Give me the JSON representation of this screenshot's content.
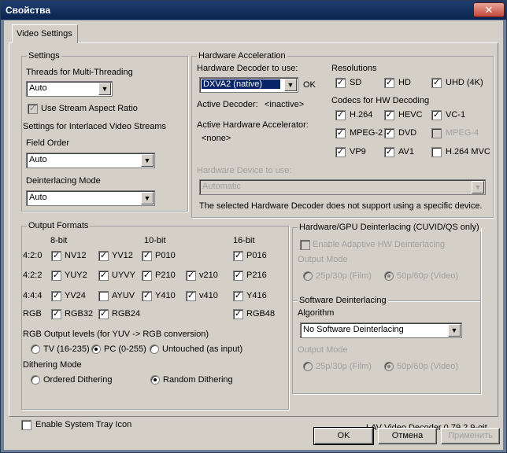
{
  "window": {
    "title": "Свойства",
    "close": "✕"
  },
  "tab": "Video Settings",
  "settings": {
    "group": "Settings",
    "threads_label": "Threads for Multi-Threading",
    "threads_value": "Auto",
    "aspect_label": "Use Stream Aspect Ratio",
    "interlaced_label": "Settings for Interlaced Video Streams",
    "field_order_label": "Field Order",
    "field_order_value": "Auto",
    "deint_mode_label": "Deinterlacing Mode",
    "deint_mode_value": "Auto"
  },
  "hwaccel": {
    "group": "Hardware Acceleration",
    "decoder_label": "Hardware Decoder to use:",
    "decoder_value": "DXVA2 (native)",
    "ok": "OK",
    "active_decoder_label": "Active Decoder:",
    "active_decoder_value": "<inactive>",
    "active_accel_label": "Active Hardware Accelerator:",
    "active_accel_value": "<none>",
    "device_label": "Hardware Device to use:",
    "device_value": "Automatic",
    "note": "The selected Hardware Decoder does not support using a specific device.",
    "resolutions_label": "Resolutions",
    "res": [
      "SD",
      "HD",
      "UHD (4K)"
    ],
    "codecs_label": "Codecs for HW Decoding",
    "codecs": [
      "H.264",
      "HEVC",
      "VC-1",
      "MPEG-2",
      "DVD",
      "MPEG-4",
      "VP9",
      "AV1",
      "H.264 MVC"
    ]
  },
  "output": {
    "group": "Output Formats",
    "h8": "8-bit",
    "h10": "10-bit",
    "h16": "16-bit",
    "rows": [
      "4:2:0",
      "4:2:2",
      "4:4:4",
      "RGB"
    ],
    "fmt": [
      "NV12",
      "YV12",
      "P010",
      "P016",
      "YUY2",
      "UYVY",
      "P210",
      "v210",
      "P216",
      "YV24",
      "AYUV",
      "Y410",
      "v410",
      "Y416",
      "RGB32",
      "RGB24",
      "RGB48"
    ],
    "levels_label": "RGB Output levels (for YUV -> RGB conversion)",
    "levels": [
      "TV (16-235)",
      "PC (0-255)",
      "Untouched (as input)"
    ],
    "dither_label": "Dithering Mode",
    "dither": [
      "Ordered Dithering",
      "Random Dithering"
    ]
  },
  "gpu_deint": {
    "group": "Hardware/GPU Deinterlacing (CUVID/QS only)",
    "adaptive": "Enable Adaptive HW Deinterlacing",
    "out_mode": "Output Mode",
    "opt1": "25p/30p (Film)",
    "opt2": "50p/60p (Video)"
  },
  "sw_deint": {
    "group": "Software Deinterlacing",
    "algo_label": "Algorithm",
    "algo_value": "No Software Deinterlacing",
    "out_mode": "Output Mode",
    "opt1": "25p/30p (Film)",
    "opt2": "50p/60p (Video)"
  },
  "tray": "Enable System Tray Icon",
  "version": "LAV Video Decoder 0.79.2.9-git",
  "buttons": {
    "ok": "OK",
    "cancel": "Отмена",
    "apply": "Применить"
  }
}
